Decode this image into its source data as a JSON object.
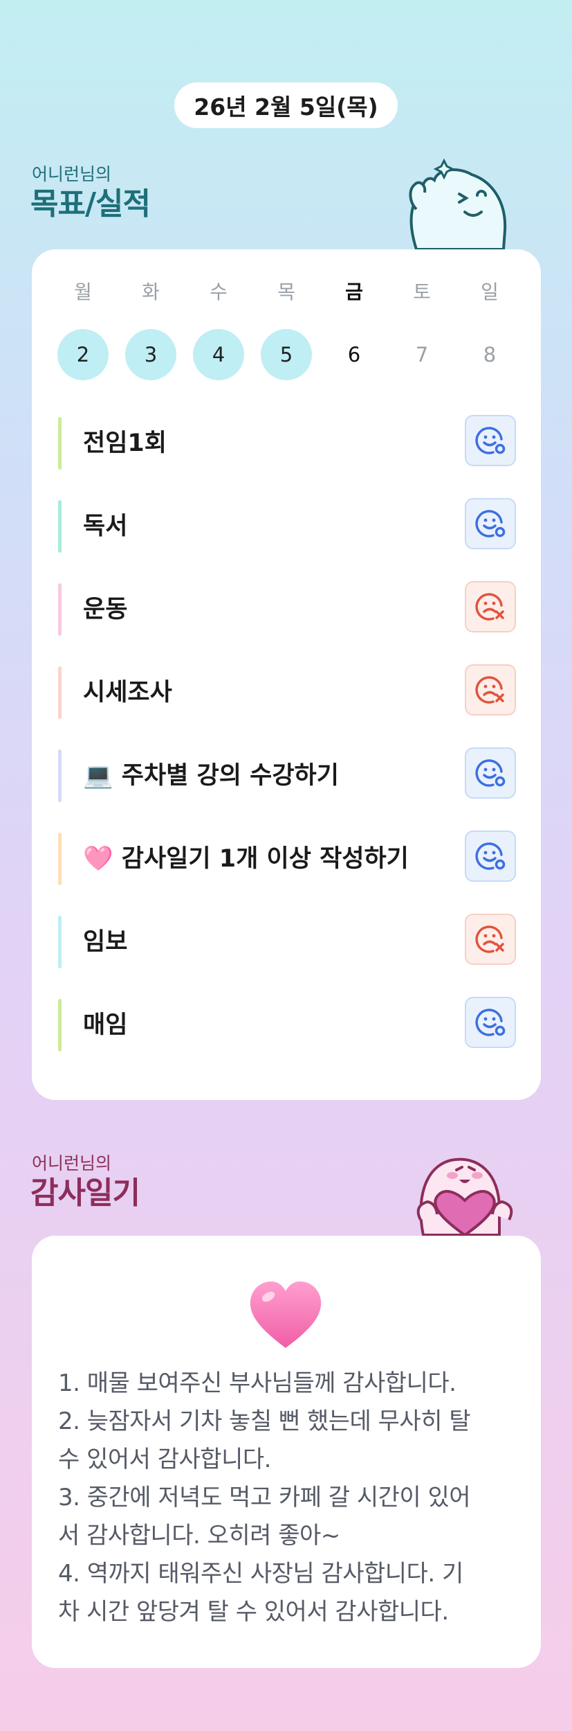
{
  "date_label": "26년 2월 5일(목)",
  "goals_section": {
    "small_title": "어니런님의",
    "big_title": "목표/실적"
  },
  "week": [
    {
      "name": "월",
      "num": "2",
      "state": "done"
    },
    {
      "name": "화",
      "num": "3",
      "state": "done"
    },
    {
      "name": "수",
      "num": "4",
      "state": "done"
    },
    {
      "name": "목",
      "num": "5",
      "state": "done"
    },
    {
      "name": "금",
      "num": "6",
      "state": "today"
    },
    {
      "name": "토",
      "num": "7",
      "state": "future"
    },
    {
      "name": "일",
      "num": "8",
      "state": "future"
    }
  ],
  "goals": [
    {
      "label": "전임1회",
      "bar_color": "#cdeb9a",
      "status": "success"
    },
    {
      "label": "독서",
      "bar_color": "#a9ebdc",
      "status": "success"
    },
    {
      "label": "운동",
      "bar_color": "#f8c9e2",
      "status": "fail"
    },
    {
      "label": "시세조사",
      "bar_color": "#fbd4cc",
      "status": "fail"
    },
    {
      "label": "💻 주차별 강의 수강하기",
      "bar_color": "#d3dcf7",
      "status": "success"
    },
    {
      "label": "🩷 감사일기 1개 이상 작성하기",
      "bar_color": "#fde0b8",
      "status": "success"
    },
    {
      "label": "임보",
      "bar_color": "#bfeef4",
      "status": "fail"
    },
    {
      "label": "매임",
      "bar_color": "#cdeb9a",
      "status": "success"
    }
  ],
  "diary_section": {
    "small_title": "어니런님의",
    "big_title": "감사일기"
  },
  "diary_lines": [
    "1. 매물 보여주신 부사님들께 감사합니다.",
    "2. 늦잠자서 기차 놓칠 뻔 했는데 무사히 탈",
    "수 있어서 감사합니다.",
    "3. 중간에 저녁도 먹고 카페 갈 시간이 있어",
    "서 감사합니다. 오히려 좋아~",
    "4. 역까지 태워주신 사장님 감사합니다. 기",
    "차 시간 앞당겨 탈 수 있어서 감사합니다."
  ],
  "colors": {
    "goals_title": "#1e6f78",
    "diary_title": "#8d2d5b",
    "success": "#3d6fe0",
    "fail": "#e2533c"
  }
}
